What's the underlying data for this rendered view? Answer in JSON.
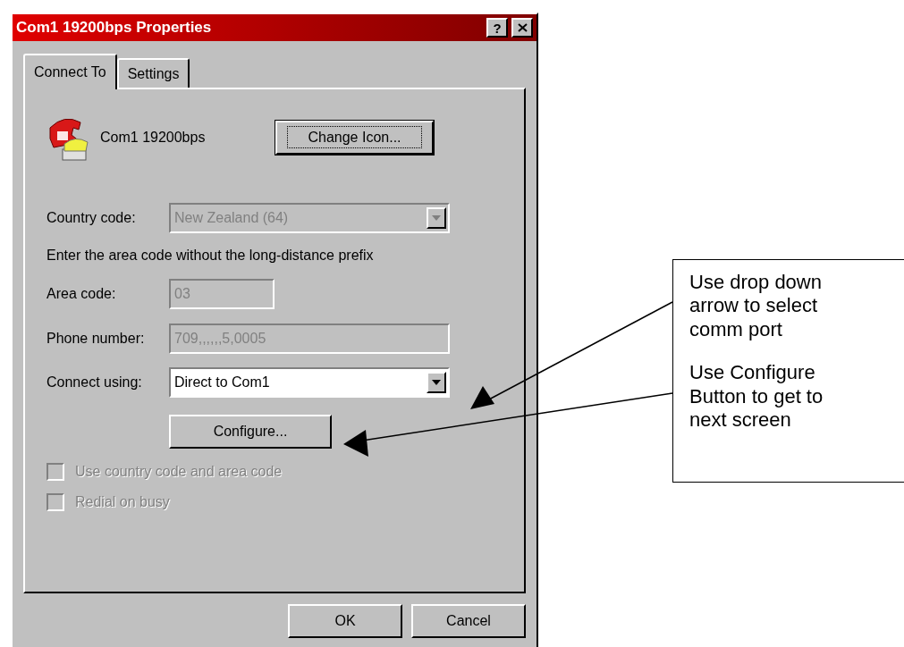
{
  "window": {
    "title": "Com1 19200bps Properties",
    "help_button": "?"
  },
  "tabs": [
    {
      "label": "Connect To",
      "selected": true
    },
    {
      "label": "Settings",
      "selected": false
    }
  ],
  "connection": {
    "name": "Com1 19200bps",
    "change_icon_button": "Change Icon..."
  },
  "rows": [
    {
      "kind": "combo",
      "label": "Country code:",
      "value": "New Zealand (64)",
      "disabled": true,
      "wide": true
    },
    {
      "kind": "note",
      "text": "Enter the area code without the long-distance prefix"
    },
    {
      "kind": "text",
      "label": "Area code:",
      "value": "03",
      "disabled": true,
      "wide": false
    },
    {
      "kind": "text",
      "label": "Phone number:",
      "value": "709,,,,,,5,0005",
      "disabled": true,
      "wide": true
    },
    {
      "kind": "combo",
      "label": "Connect using:",
      "value": "Direct to Com1",
      "disabled": false,
      "wide": true
    }
  ],
  "configure_button": "Configure...",
  "checkboxes": [
    {
      "label": "Use country code and area code",
      "checked": false,
      "disabled": true
    },
    {
      "label": "Redial on busy",
      "checked": false,
      "disabled": true
    }
  ],
  "buttons": [
    "OK",
    "Cancel"
  ],
  "callout": [
    "Use drop down arrow to select comm port",
    "Use Configure Button to get to next screen"
  ]
}
